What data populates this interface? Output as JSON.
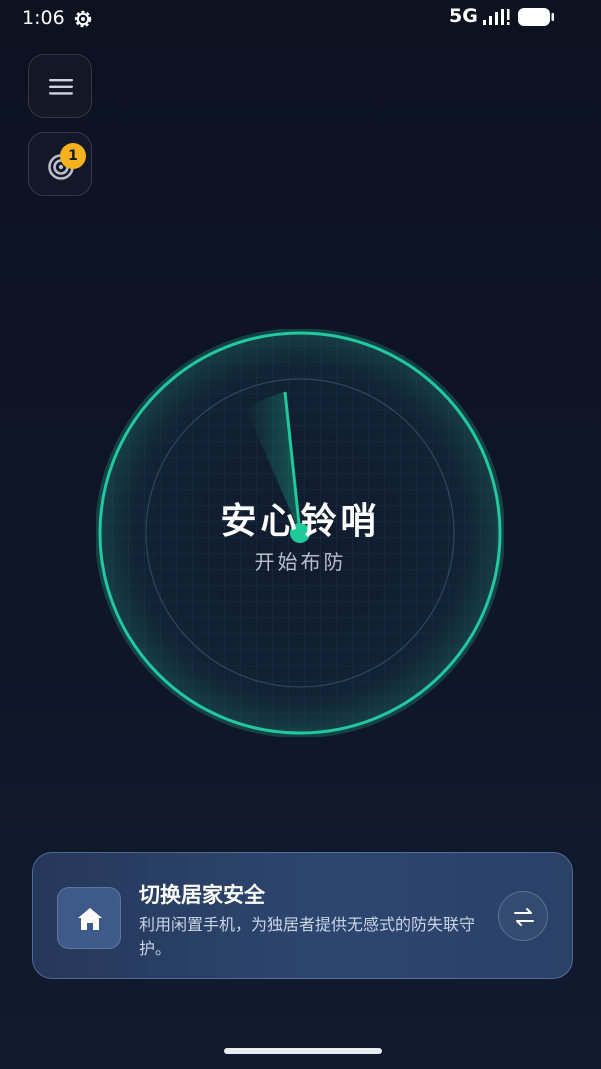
{
  "status_bar": {
    "time": "1:06",
    "network": "5G",
    "icons": [
      "gear-icon",
      "signal-icon",
      "battery-icon"
    ]
  },
  "top_buttons": {
    "menu_icon": "hamburger-menu-icon",
    "radar_icon": "radar-icon",
    "badge_count": "1"
  },
  "radar": {
    "title": "安心铃哨",
    "subtitle": "开始布防",
    "accent_color": "#1fc99a"
  },
  "card": {
    "title": "切换居家安全",
    "description": "利用闲置手机，为独居者提供无感式的防失联守护。",
    "icon": "home-icon",
    "action_icon": "swap-arrows-icon"
  },
  "colors": {
    "background": "#0c1220",
    "accent": "#1fc99a",
    "badge": "#f5b21c",
    "card": "#2d4670"
  }
}
